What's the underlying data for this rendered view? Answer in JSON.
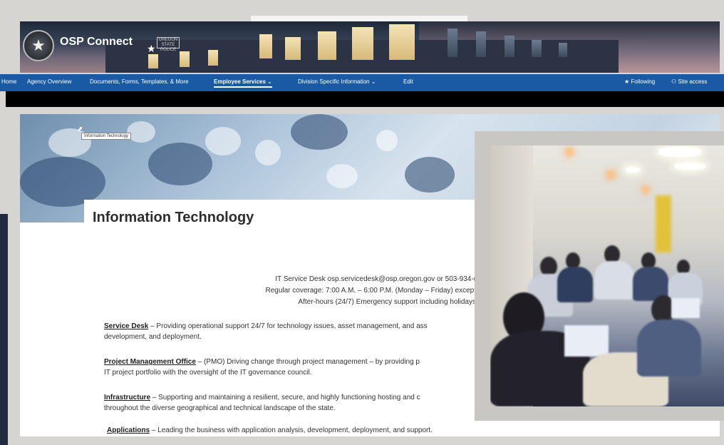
{
  "site": {
    "title": "OSP Connect",
    "sign_text": "OREGON STATE POLICE"
  },
  "nav": {
    "items": [
      {
        "label": "Home"
      },
      {
        "label": "Agency Overview"
      },
      {
        "label": "Documents, Forms, Templates, & More"
      },
      {
        "label": "Employee Services",
        "active": true
      },
      {
        "label": "Division Specific Information"
      },
      {
        "label": "Edit"
      }
    ],
    "following_label": "Following",
    "site_access_label": "Site access"
  },
  "hero": {
    "tooltip": "Information Technology"
  },
  "page": {
    "title": "Information Technology",
    "contact_lines": [
      "IT Service Desk osp.servicedesk@osp.oregon.gov or 503-934-(",
      "Regular coverage: 7:00 A.M. – 6:00 P.M. (Monday – Friday) except",
      "After-hours (24/7) Emergency support including holidays"
    ],
    "sections": [
      {
        "heading": "Service Desk",
        "text": " – Providing operational support 24/7 for technology issues, asset management, and ass",
        "text2": "development, and deployment."
      },
      {
        "heading": "Project Management Office",
        "text": " – (PMO) Driving change through project management – by providing p",
        "text2": "IT project portfolio with the oversight of the IT governance council."
      },
      {
        "heading": "Infrastructure",
        "text": " – Supporting and maintaining a resilient, secure, and highly functioning hosting and c",
        "text2": "throughout the diverse geographical and technical landscape of the state."
      },
      {
        "heading": "Applications",
        "text": " – Leading the business with application analysis, development, deployment, and support."
      }
    ]
  },
  "icons": {
    "badge": "star-badge-icon",
    "following": "star-icon",
    "site_access": "people-icon",
    "nav_chevron": "chevron-down-icon"
  },
  "colors": {
    "nav_bar": "#1a5aa5",
    "background": "#d6d5d1",
    "dark_side": "#202a40"
  }
}
